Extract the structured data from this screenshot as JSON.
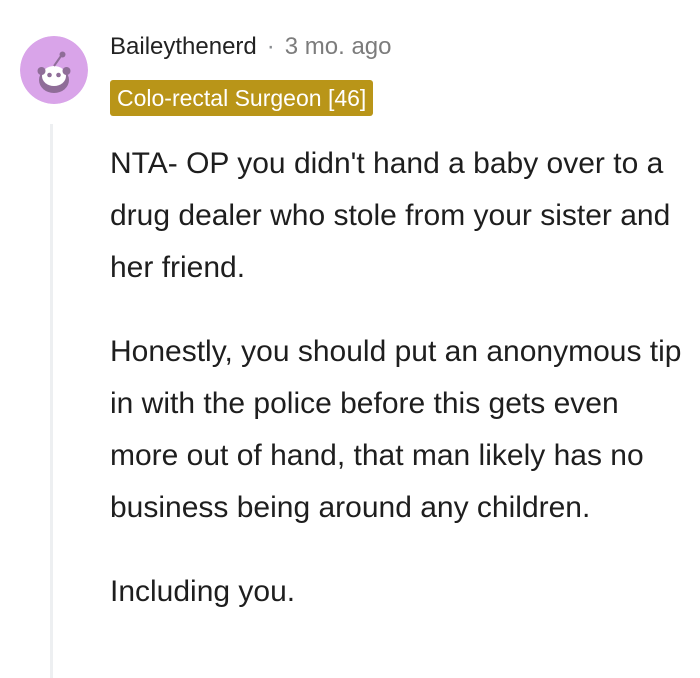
{
  "comment": {
    "author": {
      "username": "Baileythenerd",
      "avatar_icon": "reddit-snoo-avatar-icon",
      "avatar_bg": "#d9a4e9"
    },
    "separator": "·",
    "timestamp": "3 mo. ago",
    "flair": {
      "text": "Colo-rectal Surgeon [46]",
      "bg": "#b99518"
    },
    "paragraphs": [
      "NTA- OP you didn't hand a baby over to a drug dealer who stole from your sister and her friend.",
      "Honestly, you should put an anonymous tip in with the police before this gets even more out of hand, that man likely has no business being around any children.",
      "Including you."
    ]
  }
}
